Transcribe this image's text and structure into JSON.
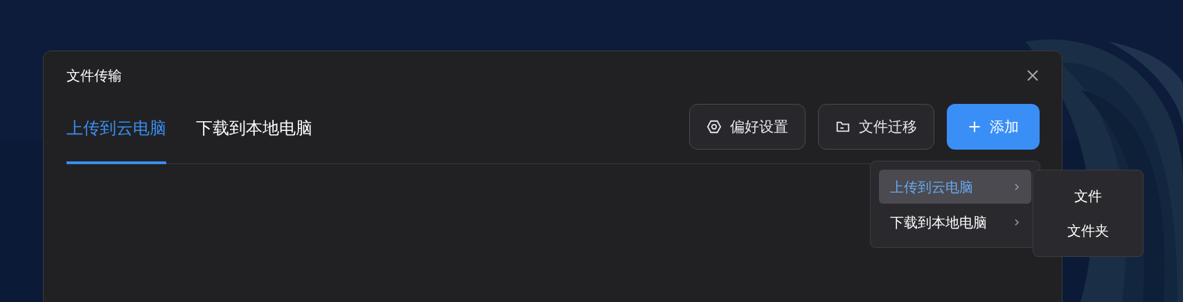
{
  "dialog": {
    "title": "文件传输"
  },
  "tabs": [
    {
      "label": "上传到云电脑",
      "selected": true
    },
    {
      "label": "下载到本地电脑",
      "selected": false
    }
  ],
  "toolbar": [
    {
      "kind": "settings",
      "label": "偏好设置"
    },
    {
      "kind": "folder",
      "label": "文件迁移"
    },
    {
      "kind": "add",
      "label": "添加"
    }
  ],
  "add_menu": {
    "items": [
      {
        "label": "上传到云电脑",
        "selected": true
      },
      {
        "label": "下载到本地电脑",
        "selected": false
      }
    ],
    "submenu": [
      "文件",
      "文件夹"
    ]
  }
}
